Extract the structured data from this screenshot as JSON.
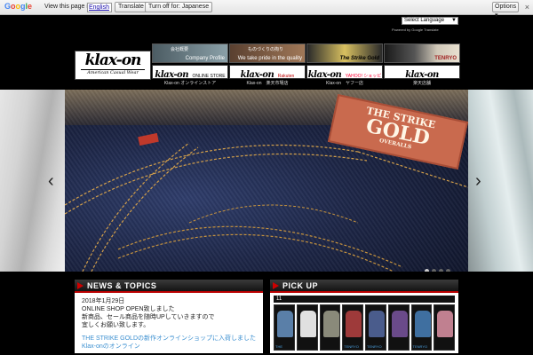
{
  "translate_bar": {
    "logo": "Google",
    "prompt": "View this page in:",
    "language": "English",
    "translate_label": "Translate",
    "turn_off_label": "Turn off for: Japanese",
    "options_label": "Options ▾",
    "close": "×"
  },
  "header": {
    "language_select": "Select Language",
    "powered": "Powered by Google Translate",
    "logo_main": "klax-on",
    "logo_sub": "American Casual Wear"
  },
  "nav": [
    {
      "top_text": "Company Profile",
      "top_text2": "会社概要",
      "button_text": "klax-on",
      "button_small": "ONLINE STORE",
      "label": "Klax-on オンラインストア",
      "top_color": "#6e7f86"
    },
    {
      "top_text": "We take pride in the quality",
      "top_text2": "ものづくりの拘り",
      "button_text": "klax-on",
      "button_small": "Rakuten",
      "label": "Klax-on　楽天市場店",
      "top_color": "#7d6248"
    },
    {
      "top_text": "The Strike Gold",
      "top_text2": "",
      "button_text": "klax-on",
      "button_small": "YAHOO! ショッピング",
      "label": "Klax-on　ヤフー店",
      "top_color": "#b8a03a"
    },
    {
      "top_text": "TENRYO",
      "top_text2": "",
      "button_text": "klax-on",
      "button_small": "",
      "label": "楽天店舗",
      "top_color": "#33363d"
    }
  ],
  "slider": {
    "patch_line1": "THE STRIKE",
    "patch_line2": "GOLD",
    "patch_line3": "OVERALLS",
    "dots": 4,
    "active_dot": 0
  },
  "news": {
    "title": "NEWS & TOPICS",
    "date": "2018年1月29日",
    "line1": "ONLINE SHOP OPEN致しました",
    "line2": "新商品、セール商品を随時UPしていきますので",
    "line3": "宜しくお願い致します。",
    "link1": "THE STRIKE GOLDの新作オンラインショップに入荷しました",
    "link2": "Klax-onのオンライン"
  },
  "pickup": {
    "title": "PICK UP",
    "bar": "11",
    "items": [
      {
        "label": "THE",
        "color": "#5a7fa8"
      },
      {
        "label": "",
        "color": "#e0e0e0"
      },
      {
        "label": "",
        "color": "#8a8a7a"
      },
      {
        "label": "TENRYO",
        "color": "#9e3a3a"
      },
      {
        "label": "TENRYO",
        "color": "#4a5c8c"
      },
      {
        "label": "",
        "color": "#6a4a8a"
      },
      {
        "label": "TENRYO",
        "color": "#3f6fa0"
      },
      {
        "label": "",
        "color": "#c08090"
      }
    ]
  }
}
